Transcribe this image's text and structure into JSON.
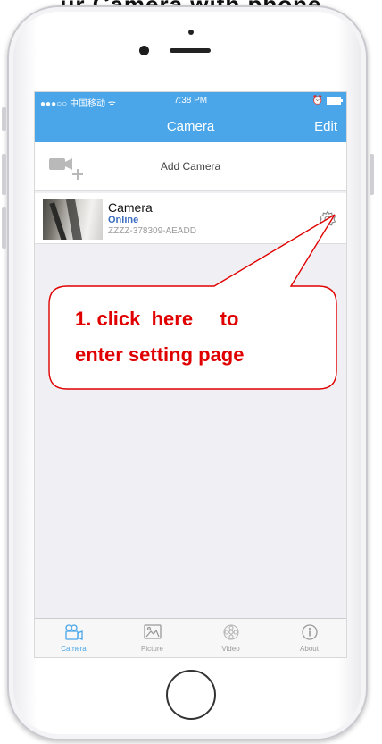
{
  "top_cut_text": "ur Camera with phone",
  "status_bar": {
    "carrier": "●●●○○ 中国移动 ᯤ",
    "time": "7:38 PM"
  },
  "nav": {
    "title": "Camera",
    "edit_label": "Edit"
  },
  "add_camera": {
    "label": "Add Camera"
  },
  "camera": {
    "name": "Camera",
    "status": "Online",
    "uid": "ZZZZ-378309-AEADD"
  },
  "annotation": {
    "line1": "1. click  here     to",
    "line2": "enter setting page",
    "color": "#e00000"
  },
  "tabs": [
    {
      "label": "Camera",
      "icon": "camera-icon",
      "active": true
    },
    {
      "label": "Picture",
      "icon": "picture-icon",
      "active": false
    },
    {
      "label": "Video",
      "icon": "video-icon",
      "active": false
    },
    {
      "label": "About",
      "icon": "info-icon",
      "active": false
    }
  ],
  "colors": {
    "accent": "#4aa6e9",
    "online": "#3a6dc0"
  }
}
